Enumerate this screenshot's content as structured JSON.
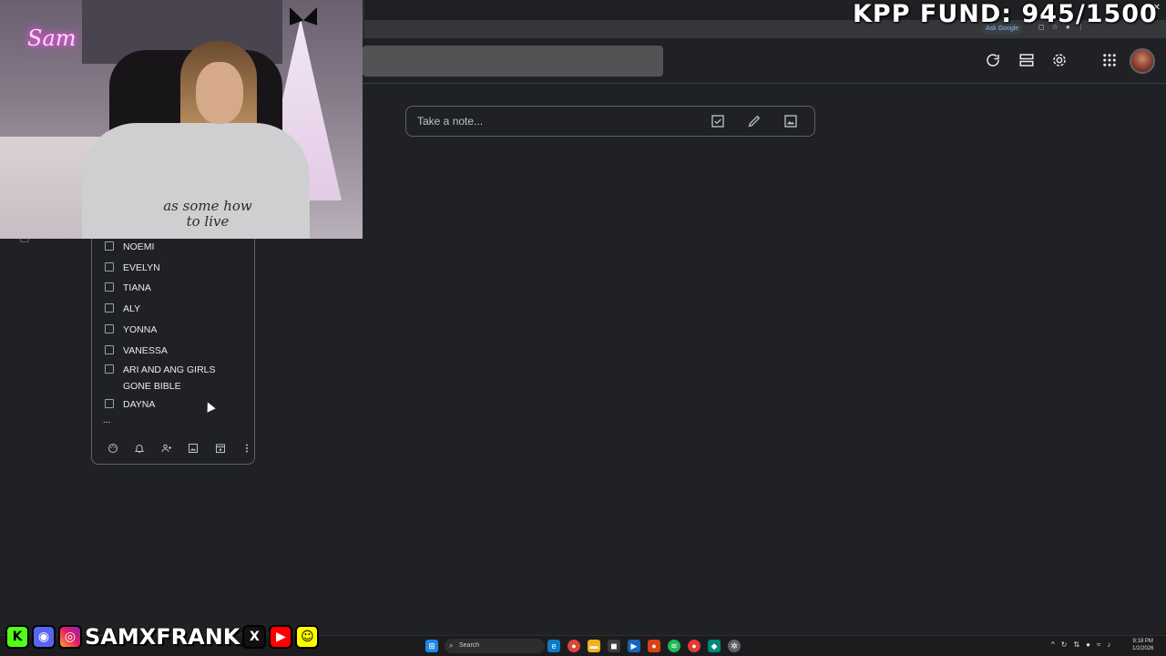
{
  "overlay": {
    "fund_text": "KPP FUND: 945/1500",
    "webcam_sign": "Sam",
    "shirt_text": "as some how to live",
    "social_handle": "SAMXFRANK"
  },
  "browser": {
    "ask_google_label": "Ask Google",
    "close_glyph": "✕"
  },
  "keep": {
    "take_note_placeholder": "Take a note...",
    "checklist": [
      {
        "text": "NOEMI",
        "checked": false
      },
      {
        "text": "EVELYN",
        "checked": false
      },
      {
        "text": "TIANA",
        "checked": false
      },
      {
        "text": "ALY",
        "checked": false
      },
      {
        "text": "YONNA",
        "checked": false
      },
      {
        "text": "VANESSA",
        "checked": false
      },
      {
        "text": "ARI AND ANG GIRLS GONE BIBLE",
        "checked": false
      },
      {
        "text": "DAYNA",
        "checked": false
      }
    ],
    "more_indicator": "...",
    "header_icons": [
      "refresh-icon",
      "list-view-icon",
      "settings-icon",
      "apps-grid-icon"
    ],
    "card_toolbar_icons": [
      "palette-icon",
      "bell-icon",
      "collaborator-icon",
      "image-icon",
      "archive-icon",
      "more-vert-icon"
    ]
  },
  "taskbar": {
    "search_label": "Search",
    "time": "9:18 PM",
    "date": "1/2/2026"
  },
  "colors": {
    "background": "#202124",
    "border": "#5f6368",
    "text": "#e8eaed"
  }
}
